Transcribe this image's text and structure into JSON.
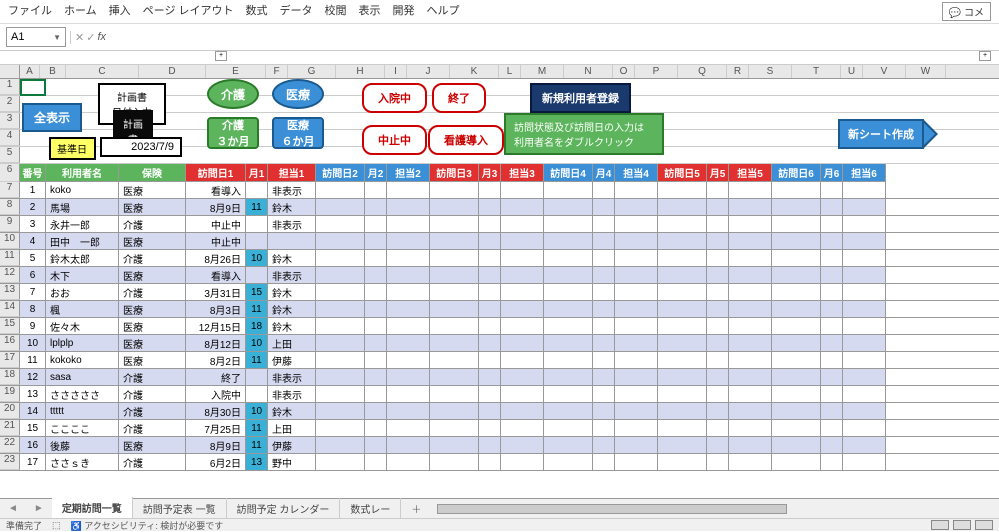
{
  "menu": [
    "ファイル",
    "ホーム",
    "挿入",
    "ページ レイアウト",
    "数式",
    "データ",
    "校閲",
    "表示",
    "開発",
    "ヘルプ"
  ],
  "comment_btn": "コメ",
  "name_box": "A1",
  "formula": "",
  "controls": {
    "show_all": "全表示",
    "plan_date": "計画書　日付入力",
    "plan": "計画書",
    "care": "介護",
    "medical": "医療",
    "care3m_1": "介護",
    "care3m_2": "３か月",
    "med6m_1": "医療",
    "med6m_2": "６か月",
    "admit": "入院中",
    "end": "終了",
    "stop": "中止中",
    "nurse_intro": "看護導入",
    "new_user": "新規利用者登録",
    "info1": "訪問状態及び訪問日の入力は",
    "info2": "利用者名をダブルクリック",
    "new_sheet": "新シート作成",
    "ref_date_lbl": "基準日",
    "ref_date_val": "2023/7/9"
  },
  "headers": [
    "番号",
    "利用者名",
    "保険",
    "訪問日1",
    "月1",
    "担当1",
    "訪問日2",
    "月2",
    "担当2",
    "訪問日3",
    "月3",
    "担当3",
    "訪問日4",
    "月4",
    "担当4",
    "訪問日5",
    "月5",
    "担当5",
    "訪問日6",
    "月6",
    "担当6"
  ],
  "rows": [
    {
      "n": 1,
      "name": "koko",
      "ins": "医療",
      "d1": "看導入",
      "m1": "",
      "t1": "非表示"
    },
    {
      "n": 2,
      "name": "馬場",
      "ins": "医療",
      "d1": "8月9日",
      "m1": "11",
      "t1": "鈴木"
    },
    {
      "n": 3,
      "name": "永井一郎",
      "ins": "介護",
      "d1": "中止中",
      "m1": "",
      "t1": "非表示"
    },
    {
      "n": 4,
      "name": "田中　一郎",
      "ins": "医療",
      "d1": "中止中",
      "m1": "",
      "t1": ""
    },
    {
      "n": 5,
      "name": "鈴木太郎",
      "ins": "介護",
      "d1": "8月26日",
      "m1": "10",
      "t1": "鈴木"
    },
    {
      "n": 6,
      "name": "木下",
      "ins": "医療",
      "d1": "看導入",
      "m1": "",
      "t1": "非表示"
    },
    {
      "n": 7,
      "name": "おお",
      "ins": "介護",
      "d1": "3月31日",
      "m1": "15",
      "t1": "鈴木"
    },
    {
      "n": 8,
      "name": "楓",
      "ins": "医療",
      "d1": "8月3日",
      "m1": "11",
      "t1": "鈴木"
    },
    {
      "n": 9,
      "name": "佐々木",
      "ins": "医療",
      "d1": "12月15日",
      "m1": "18",
      "t1": "鈴木"
    },
    {
      "n": 10,
      "name": "lplplp",
      "ins": "医療",
      "d1": "8月12日",
      "m1": "10",
      "t1": "上田"
    },
    {
      "n": 11,
      "name": "kokoko",
      "ins": "医療",
      "d1": "8月2日",
      "m1": "11",
      "t1": "伊藤"
    },
    {
      "n": 12,
      "name": "sasa",
      "ins": "介護",
      "d1": "終了",
      "m1": "",
      "t1": "非表示"
    },
    {
      "n": 13,
      "name": "さささささ",
      "ins": "介護",
      "d1": "入院中",
      "m1": "",
      "t1": "非表示"
    },
    {
      "n": 14,
      "name": "ttttt",
      "ins": "介護",
      "d1": "8月30日",
      "m1": "10",
      "t1": "鈴木"
    },
    {
      "n": 15,
      "name": "ここここ",
      "ins": "介護",
      "d1": "7月25日",
      "m1": "11",
      "t1": "上田"
    },
    {
      "n": 16,
      "name": "後藤",
      "ins": "医療",
      "d1": "8月9日",
      "m1": "11",
      "t1": "伊藤"
    },
    {
      "n": 17,
      "name": "ささｓき",
      "ins": "介護",
      "d1": "6月2日",
      "m1": "13",
      "t1": "野中"
    }
  ],
  "tabs": [
    "定期訪問一覧",
    "訪問予定表 一覧",
    "訪問予定 カレンダー",
    "数式レー"
  ],
  "status": {
    "ready": "準備完了",
    "acc": "アクセシビリティ: 検討が必要です",
    "circ": "⬚"
  }
}
